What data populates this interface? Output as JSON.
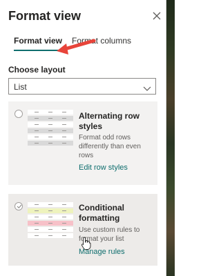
{
  "panel": {
    "title": "Format view",
    "close_icon": "close-icon",
    "accent_color": "#0f6e6e"
  },
  "tabs": [
    {
      "label": "Format view",
      "selected": true
    },
    {
      "label": "Format columns",
      "selected": false
    }
  ],
  "layout": {
    "label": "Choose layout",
    "selected_value": "List",
    "chevron_icon": "chevron-down-icon"
  },
  "options": [
    {
      "title": "Alternating row styles",
      "description": "Format odd rows differently than even rows",
      "link": "Edit row styles",
      "selected": false
    },
    {
      "title": "Conditional formatting",
      "description": "Use custom rules to format your list",
      "link": "Manage rules",
      "selected": true
    }
  ]
}
